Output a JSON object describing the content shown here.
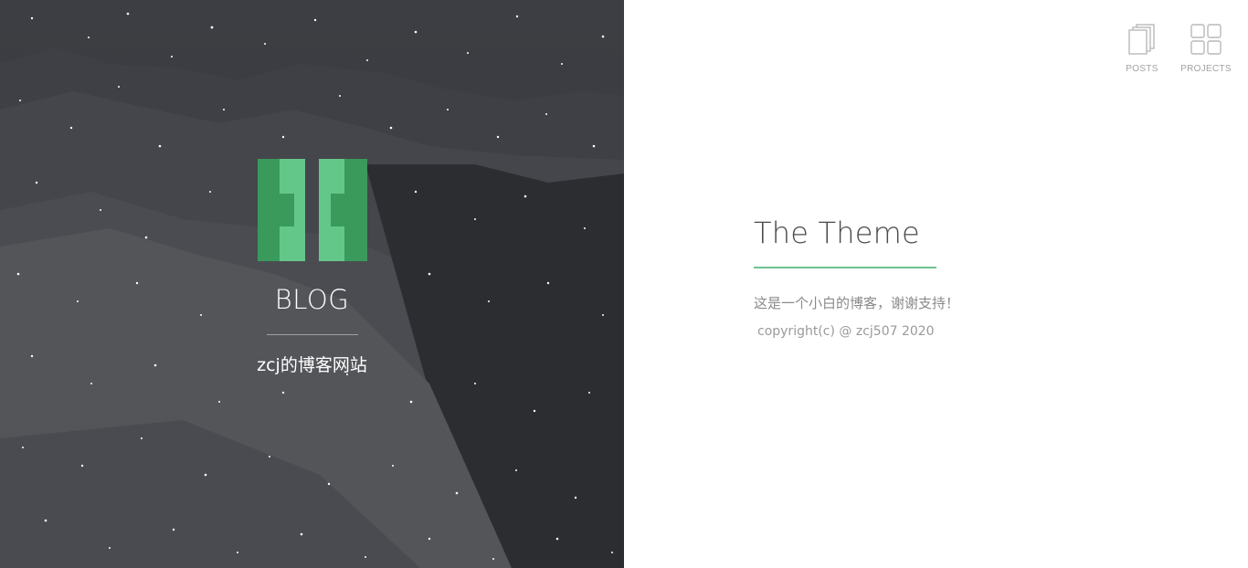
{
  "hero": {
    "title": "BLOG",
    "subtitle": "zcj的博客网站"
  },
  "nav": {
    "items": [
      {
        "label": "POSTS",
        "icon": "posts-stack-icon"
      },
      {
        "label": "PROJECTS",
        "icon": "grid-icon"
      }
    ]
  },
  "content": {
    "title": "The Theme",
    "description": "这是一个小白的博客，谢谢支持！",
    "copyright": "copyright(c) @ zcj507 2020"
  },
  "colors": {
    "accent": "#6fc18e",
    "logo_dark": "#3a9a5b",
    "logo_light": "#64c78a",
    "panel_dark": "#3b3c40"
  }
}
